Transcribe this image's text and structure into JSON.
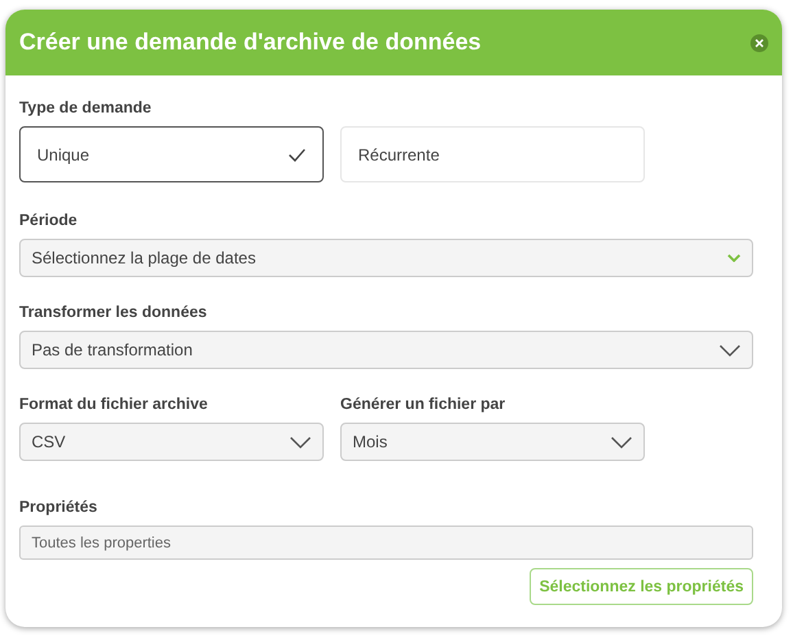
{
  "dialog": {
    "title": "Créer une demande d'archive de données"
  },
  "request_type": {
    "label": "Type de demande",
    "options": [
      {
        "label": "Unique",
        "selected": true
      },
      {
        "label": "Récurrente",
        "selected": false
      }
    ]
  },
  "period": {
    "label": "Période",
    "kind": "date-range",
    "value": "Sélectionnez la plage de dates"
  },
  "transform": {
    "label": "Transformer les données",
    "kind": "select",
    "value": "Pas de transformation"
  },
  "row_fields": [
    {
      "label": "Format du fichier archive",
      "kind": "select",
      "value": "CSV"
    },
    {
      "label": "Générer un fichier par",
      "kind": "select",
      "value": "Mois"
    }
  ],
  "properties": {
    "label": "Propriétés",
    "placeholder": "Toutes les properties",
    "button": "Sélectionnez les propriétés"
  }
}
